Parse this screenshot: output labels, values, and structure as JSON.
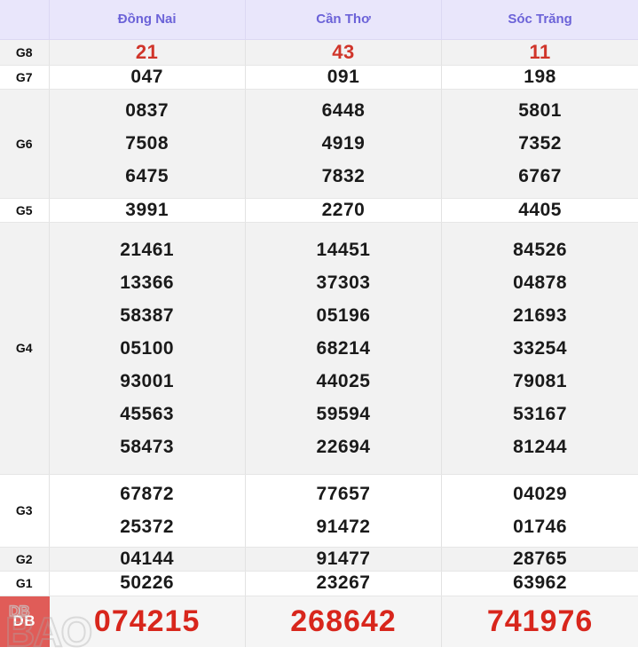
{
  "table": {
    "corner_label": "",
    "columns": [
      "Đồng Nai",
      "Cần Thơ",
      "Sóc Trăng"
    ],
    "rows": [
      {
        "label": "G8",
        "style": "shade",
        "values": [
          [
            "21"
          ],
          [
            "43"
          ],
          [
            "11"
          ]
        ]
      },
      {
        "label": "G7",
        "style": "plain",
        "values": [
          [
            "047"
          ],
          [
            "091"
          ],
          [
            "198"
          ]
        ]
      },
      {
        "label": "G6",
        "style": "shade",
        "values": [
          [
            "0837",
            "7508",
            "6475"
          ],
          [
            "6448",
            "4919",
            "7832"
          ],
          [
            "5801",
            "7352",
            "6767"
          ]
        ]
      },
      {
        "label": "G5",
        "style": "plain",
        "values": [
          [
            "3991"
          ],
          [
            "2270"
          ],
          [
            "4405"
          ]
        ]
      },
      {
        "label": "G4",
        "style": "shade",
        "values": [
          [
            "21461",
            "13366",
            "58387",
            "05100",
            "93001",
            "45563",
            "58473"
          ],
          [
            "14451",
            "37303",
            "05196",
            "68214",
            "44025",
            "59594",
            "22694"
          ],
          [
            "84526",
            "04878",
            "21693",
            "33254",
            "79081",
            "53167",
            "81244"
          ]
        ]
      },
      {
        "label": "G3",
        "style": "plain",
        "values": [
          [
            "67872",
            "25372"
          ],
          [
            "77657",
            "91472"
          ],
          [
            "04029",
            "01746"
          ]
        ]
      },
      {
        "label": "G2",
        "style": "shade",
        "values": [
          [
            "04144"
          ],
          [
            "91477"
          ],
          [
            "28765"
          ]
        ]
      },
      {
        "label": "G1",
        "style": "plain",
        "values": [
          [
            "50226"
          ],
          [
            "23267"
          ],
          [
            "63962"
          ]
        ]
      },
      {
        "label": "DB",
        "style": "db",
        "values": [
          [
            "074215"
          ],
          [
            "268642"
          ],
          [
            "741976"
          ]
        ]
      }
    ]
  },
  "watermark": {
    "line1": "DB",
    "line2": "BAO",
    "text": "BAO"
  },
  "colors": {
    "header_bg": "#e9e6fb",
    "header_text": "#6c63d8",
    "g8_red": "#d0352a",
    "db_red": "#d8261c",
    "db_label_bg": "#e05c58",
    "row_shade": "#f2f2f2",
    "row_plain": "#ffffff"
  }
}
